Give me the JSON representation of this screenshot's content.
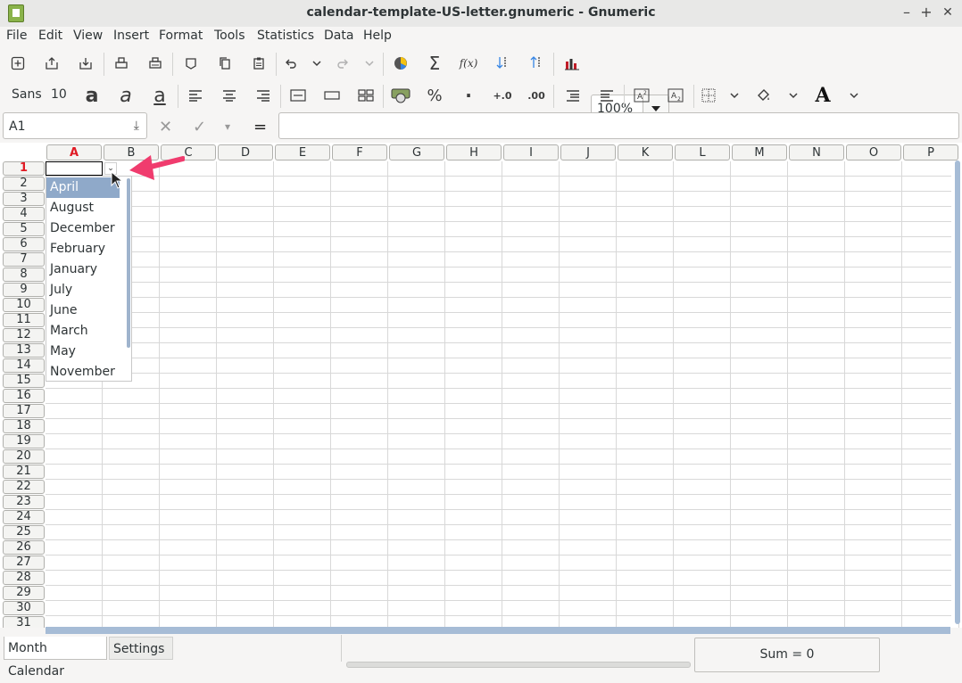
{
  "window": {
    "title": "calendar-template-US-letter.gnumeric - Gnumeric",
    "minimize": "–",
    "maximize": "+",
    "close": "✕"
  },
  "menu": [
    "File",
    "Edit",
    "View",
    "Insert",
    "Format",
    "Tools",
    "Statistics",
    "Data",
    "Help"
  ],
  "toolbar": {
    "zoom_value": "100%",
    "font_name": "Sans",
    "font_size": "10",
    "bold_glyph": "a",
    "italic_glyph": "a",
    "underline_glyph": "a",
    "percent": "%",
    "thousands": "·",
    "increase_decimals": "+.0",
    "decrease_decimals": ".00",
    "function_label": "f(x)",
    "sum_glyph": "Σ",
    "font_color_glyph": "A"
  },
  "formula_bar": {
    "cell_ref": "A1",
    "cancel_glyph": "✕",
    "accept_glyph": "✓",
    "equals_glyph": "=",
    "formula_value": ""
  },
  "columns": [
    "A",
    "B",
    "C",
    "D",
    "E",
    "F",
    "G",
    "H",
    "I",
    "J",
    "K",
    "L",
    "M",
    "N",
    "O",
    "P"
  ],
  "rows": [
    "1",
    "2",
    "3",
    "4",
    "5",
    "6",
    "7",
    "8",
    "9",
    "10",
    "11",
    "12",
    "13",
    "14",
    "15",
    "16",
    "17",
    "18",
    "19",
    "20",
    "21",
    "22",
    "23",
    "24",
    "25",
    "26",
    "27",
    "28",
    "29",
    "30",
    "31"
  ],
  "selected_cell": "A1",
  "dropdown": {
    "button_glyph": "⌄",
    "highlighted": "April",
    "items": [
      "April",
      "August",
      "December",
      "February",
      "January",
      "July",
      "June",
      "March",
      "May",
      "November"
    ]
  },
  "sheets": [
    "Month Calendar",
    "Settings"
  ],
  "active_sheet": "Month Calendar",
  "status": {
    "sum": "Sum = 0"
  },
  "colors": {
    "accent": "#e01b24",
    "highlight": "#8fa9c9",
    "annotation_arrow": "#f03c6e"
  }
}
